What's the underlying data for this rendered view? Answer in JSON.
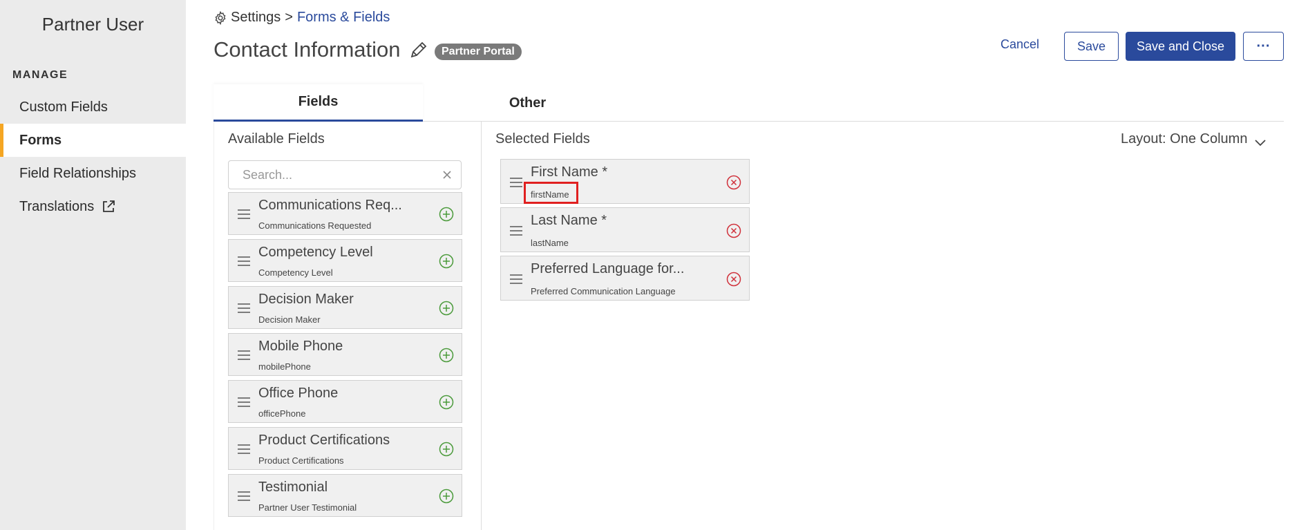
{
  "sidebar": {
    "app_title": "Partner User",
    "section_label": "MANAGE",
    "items": [
      {
        "label": "Custom Fields",
        "active": false
      },
      {
        "label": "Forms",
        "active": true
      },
      {
        "label": "Field Relationships",
        "active": false
      },
      {
        "label": "Translations",
        "active": false,
        "icon": "external-link-icon"
      }
    ]
  },
  "header": {
    "breadcrumb": {
      "root": "Settings",
      "separator": ">",
      "current": "Forms & Fields"
    },
    "title": "Contact Information",
    "badge": "Partner Portal",
    "actions": {
      "cancel": "Cancel",
      "save": "Save",
      "save_close": "Save and Close",
      "more": "···"
    }
  },
  "tabs": [
    {
      "label": "Fields",
      "active": true
    },
    {
      "label": "Other",
      "active": false
    }
  ],
  "available": {
    "title": "Available Fields",
    "search_placeholder": "Search...",
    "fields": [
      {
        "name": "Communications Req...",
        "api": "Communications Requested"
      },
      {
        "name": "Competency Level",
        "api": "Competency Level"
      },
      {
        "name": "Decision Maker",
        "api": "Decision Maker"
      },
      {
        "name": "Mobile Phone",
        "api": "mobilePhone"
      },
      {
        "name": "Office Phone",
        "api": "officePhone"
      },
      {
        "name": "Product Certifications",
        "api": "Product Certifications"
      },
      {
        "name": "Testimonial",
        "api": "Partner User Testimonial"
      }
    ]
  },
  "selected": {
    "title": "Selected Fields",
    "layout_label": "Layout: One Column",
    "fields": [
      {
        "name": "First Name *",
        "api": "firstName"
      },
      {
        "name": "Last Name *",
        "api": "lastName"
      },
      {
        "name": "Preferred Language for...",
        "api": "Preferred Communication Language"
      }
    ]
  },
  "colors": {
    "accent": "#2a4a9c",
    "active_marker": "#f5a623",
    "add_green": "#4a9a3a",
    "remove_red": "#d0303a",
    "highlight": "#e02020"
  }
}
